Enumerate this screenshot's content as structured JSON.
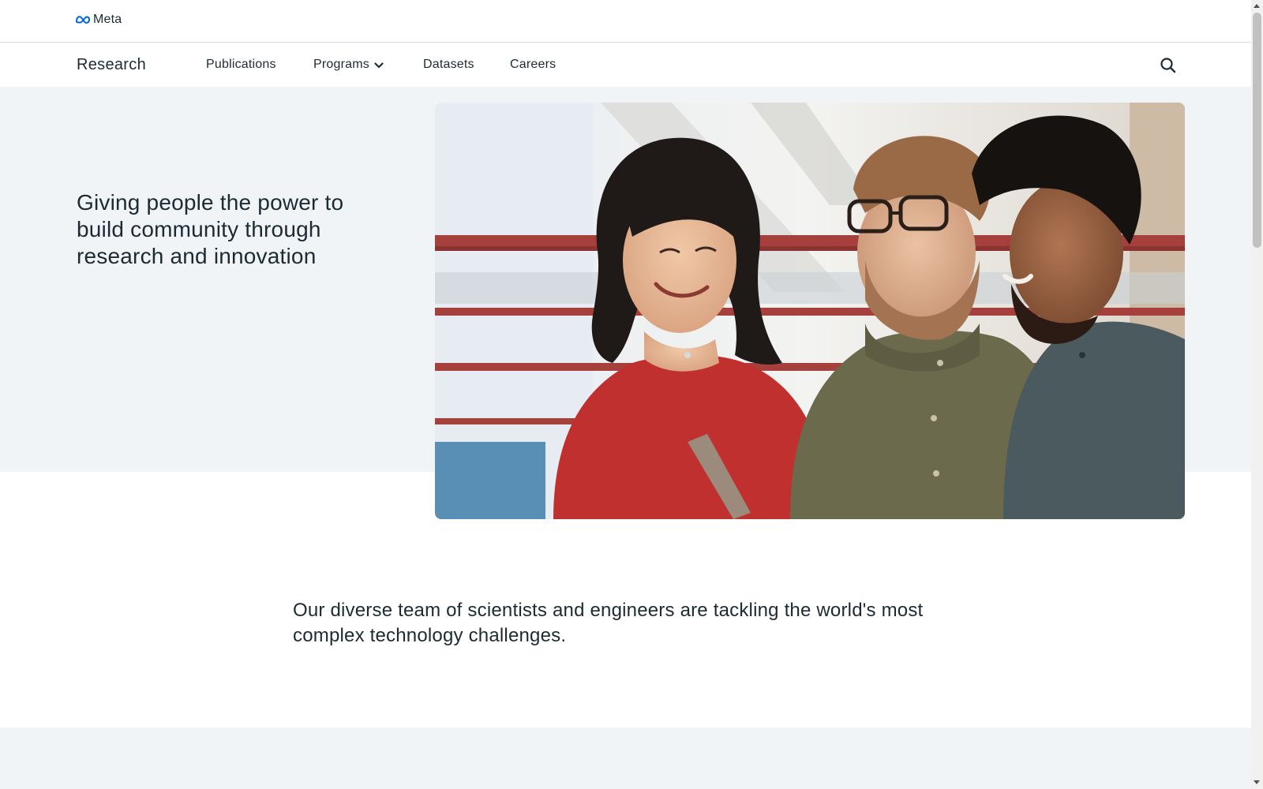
{
  "brand": {
    "name": "Meta",
    "logo_icon": "meta-infinity-logo-icon",
    "logo_color": "#0064e0"
  },
  "nav": {
    "site_title": "Research",
    "items": [
      {
        "label": "Publications"
      },
      {
        "label": "Programs",
        "has_dropdown": true,
        "icon": "chevron-down-icon"
      },
      {
        "label": "Datasets"
      },
      {
        "label": "Careers"
      }
    ],
    "search_icon": "search-icon"
  },
  "hero": {
    "heading": "Giving people the power to build community through research and innovation",
    "image_icon": "team-photo"
  },
  "mission": {
    "text": "Our diverse team of scientists and engineers are tackling the world's most complex technology challenges."
  },
  "colors": {
    "text": "#1c2b33",
    "hero_background": "#f1f4f7",
    "divider": "#d4d9dd"
  }
}
